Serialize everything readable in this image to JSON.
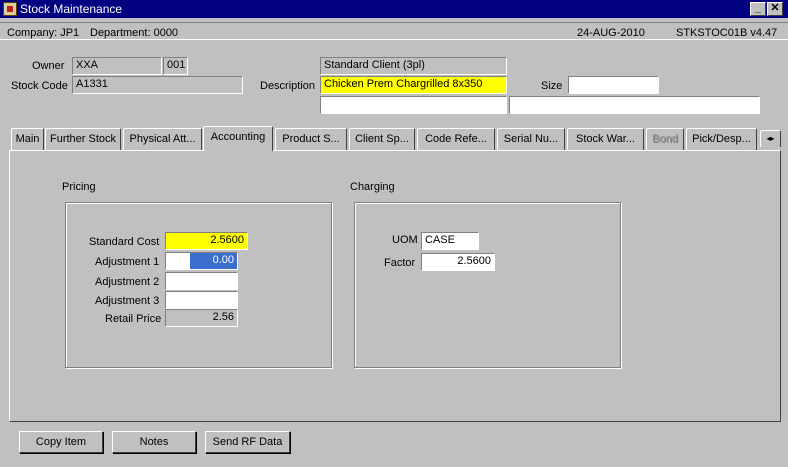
{
  "window": {
    "title": "Stock Maintenance",
    "minimize_glyph": "_",
    "close_glyph": "✕"
  },
  "info": {
    "company": "Company:  JP1",
    "department": "Department:  0000",
    "date": "24-AUG-2010",
    "version": "STKSTOC01B  v4.47"
  },
  "header": {
    "owner_label": "Owner",
    "owner_value": "XXA",
    "owner_code": "001",
    "client_name": "Standard Client (3pl)",
    "stock_code_label": "Stock Code",
    "stock_code_value": "A1331",
    "description_label": "Description",
    "description_value": "Chicken Prem Chargrilled 8x350",
    "size_label": "Size",
    "size_value": ""
  },
  "tabs": [
    {
      "label": "Main"
    },
    {
      "label": "Further Stock"
    },
    {
      "label": "Physical Att..."
    },
    {
      "label": "Accounting"
    },
    {
      "label": "Product S..."
    },
    {
      "label": "Client Sp..."
    },
    {
      "label": "Code Refe..."
    },
    {
      "label": "Serial Nu..."
    },
    {
      "label": "Stock War..."
    },
    {
      "label": "Bond"
    },
    {
      "label": "Pick/Desp..."
    }
  ],
  "tab_scroll_glyph": "◂▸",
  "pricing": {
    "title": "Pricing",
    "standard_cost_label": "Standard Cost",
    "standard_cost": "2.5600",
    "adjustment1_label": "Adjustment 1",
    "adjustment1": "0.00",
    "adjustment2_label": "Adjustment 2",
    "adjustment2": "",
    "adjustment3_label": "Adjustment 3",
    "adjustment3": "",
    "retail_price_label": "Retail Price",
    "retail_price": "2.56"
  },
  "charging": {
    "title": "Charging",
    "uom_label": "UOM",
    "uom": "CASE",
    "factor_label": "Factor",
    "factor": "2.5600"
  },
  "buttons": {
    "copy_item": "Copy Item",
    "notes": "Notes",
    "send_rf_data": "Send RF Data"
  }
}
